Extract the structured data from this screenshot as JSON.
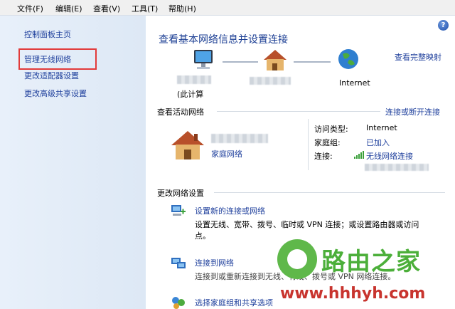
{
  "menu": [
    "文件(F)",
    "编辑(E)",
    "查看(V)",
    "工具(T)",
    "帮助(H)"
  ],
  "sidebar": {
    "items": [
      "控制面板主页",
      "管理无线网络",
      "更改适配器设置",
      "更改高级共享设置"
    ]
  },
  "main": {
    "help": "?",
    "title": "查看基本网络信息并设置连接",
    "full_map_link": "查看完整映射",
    "computer_label": "(此计算",
    "internet_label": "Internet",
    "active_section": "查看活动网络",
    "connect_disconnect_link": "连接或断开连接",
    "network_type_link": "家庭网络",
    "access_type_label": "访问类型:",
    "access_type_value": "Internet",
    "homegroup_label": "家庭组:",
    "homegroup_value": "已加入",
    "connection_label": "连接:",
    "connection_value": "无线网络连接",
    "change_section": "更改网络设置",
    "tasks": [
      {
        "title": "设置新的连接或网络",
        "desc1": "设置无线、宽带、拨号、临时或 VPN 连接；或设置路由器或访问",
        "desc2": "点。"
      },
      {
        "title": "连接到网络",
        "desc1": "连接到或重新连接到无线、有线、拨号或 VPN 网络连接。"
      },
      {
        "title": "选择家庭组和共享选项"
      }
    ]
  },
  "watermark": {
    "brand": "路由之家",
    "url": "www.hhhyh.com"
  }
}
